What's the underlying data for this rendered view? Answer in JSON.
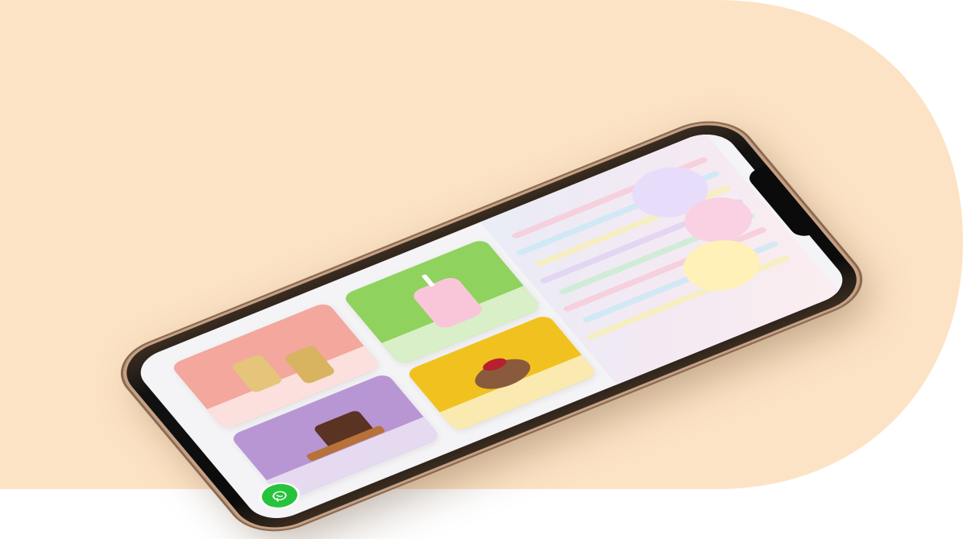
{
  "colors": {
    "background": "#ffffff",
    "backdrop_shape": "#fde3c5",
    "phone_frame": "#c7a184",
    "card_green": "#8fd25e",
    "card_yellow": "#f1c21f",
    "card_pink": "#f3a79d",
    "card_purple": "#b896d4",
    "whatsapp_green": "#27c33c"
  },
  "phone": {
    "screen": {
      "hero_image": "pastel-meringue-cake-image",
      "gallery": [
        {
          "name": "cake-with-sprinkles-and-candle",
          "color": "green"
        },
        {
          "name": "pancake-stack-with-spoon",
          "color": "yellow"
        },
        {
          "name": "golden-dessert-glasses",
          "color": "pink"
        },
        {
          "name": "chocolate-cake-slices",
          "color": "purple"
        }
      ],
      "floating_button": {
        "icon": "whatsapp-icon"
      }
    }
  }
}
